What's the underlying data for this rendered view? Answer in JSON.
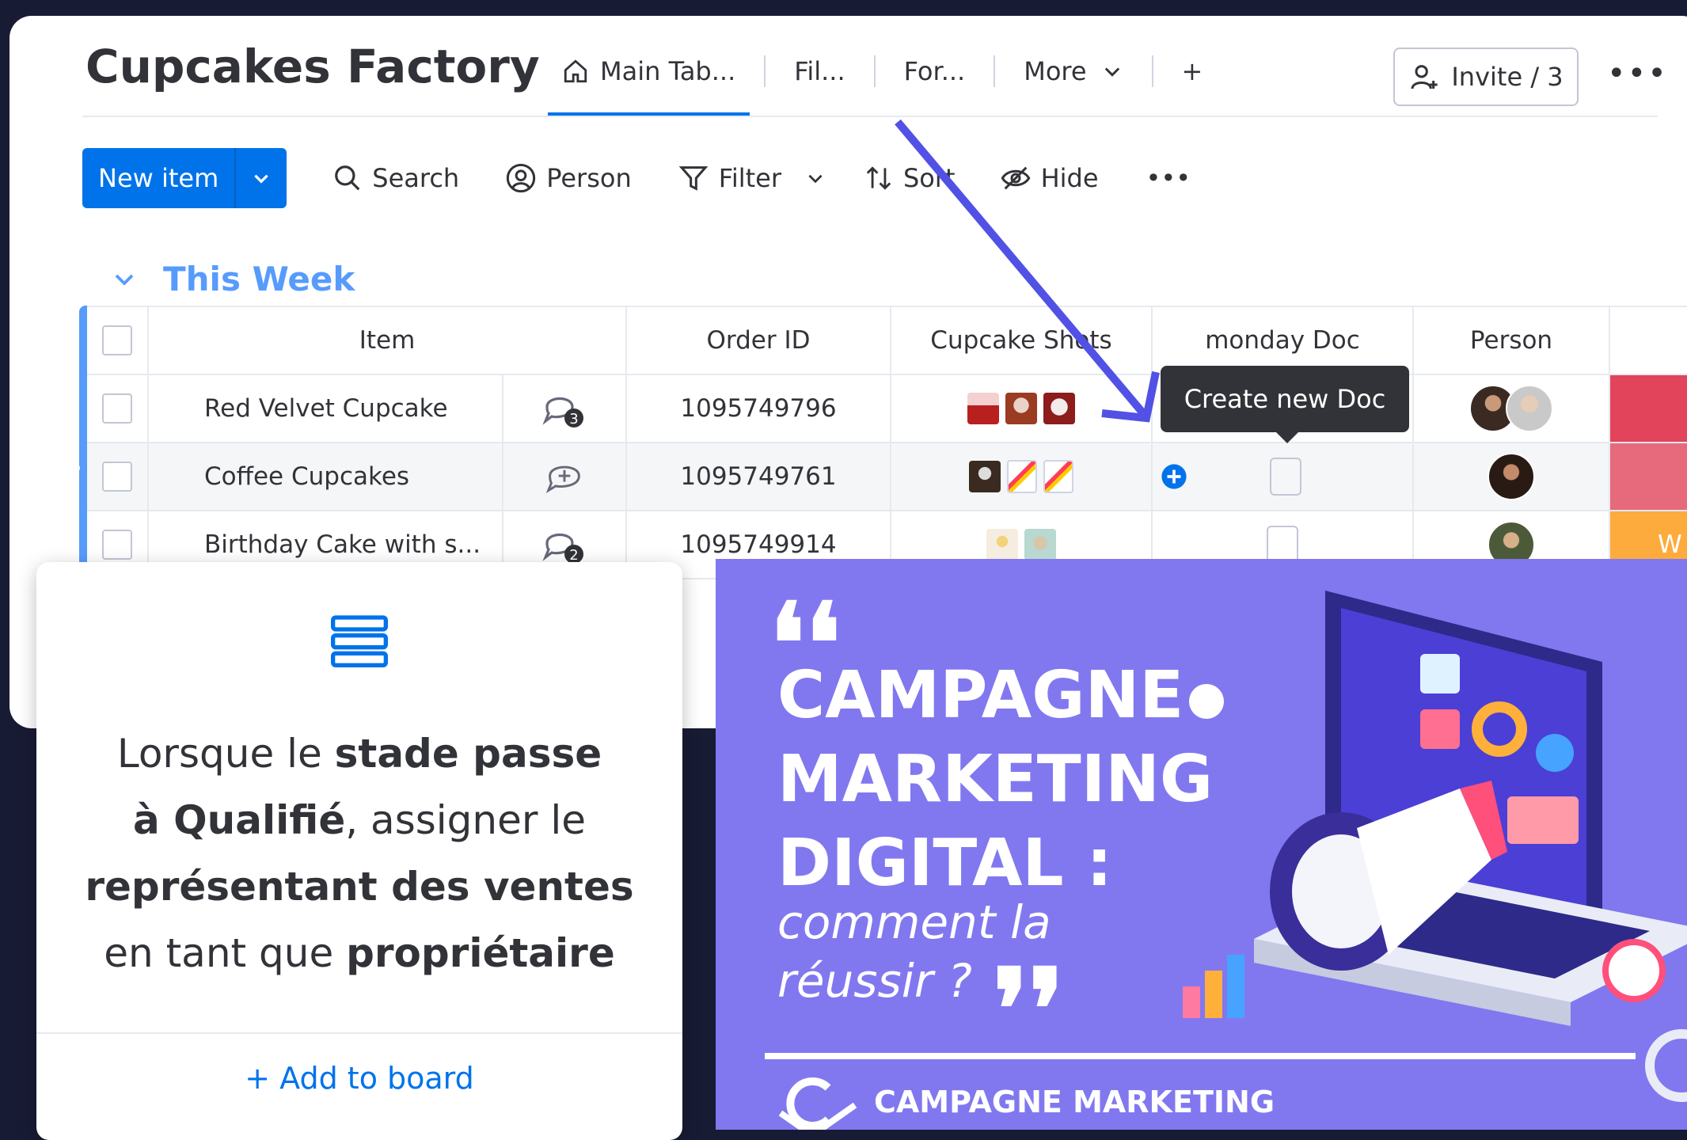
{
  "header": {
    "title": "Cupcakes Factory",
    "tabs": [
      {
        "label": "Main Tab..."
      },
      {
        "label": "Fil..."
      },
      {
        "label": "For..."
      },
      {
        "label": "More"
      }
    ],
    "add_tab": "+",
    "invite": "Invite / 3",
    "more": "•••"
  },
  "toolbar": {
    "new_item": "New item",
    "search": "Search",
    "person": "Person",
    "filter": "Filter",
    "sort": "Sort",
    "hide": "Hide",
    "more": "•••"
  },
  "group": {
    "title": "This Week"
  },
  "table": {
    "columns": [
      "Item",
      "Order ID",
      "Cupcake Shots",
      "monday Doc",
      "Person"
    ],
    "rows": [
      {
        "item": "Red Velvet Cupcake",
        "updates": "3",
        "order_id": "1095749796"
      },
      {
        "item": "Coffee Cupcakes",
        "updates": "",
        "order_id": "1095749761"
      },
      {
        "item": "Birthday Cake with s...",
        "updates": "2",
        "order_id": "1095749914"
      }
    ],
    "partial_order_id": "10",
    "partial_status": "W"
  },
  "tooltip": "Create new Doc",
  "side_more": "•••",
  "card": {
    "t1": "Lorsque le ",
    "b1": "stade passe",
    "b2": "à Qualifié",
    "t2": ", assigner le",
    "b3": "représentant des ventes",
    "t3": "en tant que ",
    "b4": "propriétaire",
    "add": "+ Add to board"
  },
  "promo": {
    "quote_open": "❛❛",
    "line1": "CAMPAGNE",
    "line2": "MARKETING",
    "line3": "DIGITAL :",
    "sub1": "comment la",
    "sub2": "réussir ?",
    "quote_close": "❜❜",
    "brand": "CAMPAGNE MARKETING"
  },
  "colors": {
    "accent": "#0073ea",
    "group": "#579bfc",
    "status_red": "#e2445c",
    "status_orange": "#fdab3d",
    "promo_bg": "#8178f0",
    "arrow": "#5151e6"
  }
}
